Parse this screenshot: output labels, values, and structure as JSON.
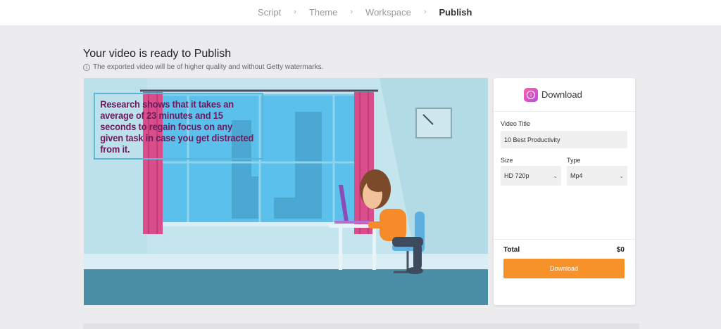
{
  "steps": [
    "Script",
    "Theme",
    "Workspace",
    "Publish"
  ],
  "active_step": "Publish",
  "page": {
    "title": "Your video is ready to Publish",
    "notice": "The exported video will be of higher quality and without Getty watermarks."
  },
  "video": {
    "caption": "Research shows that it takes an average of 23 minutes and 15 seconds to regain focus on any given task in case you get distracted from it."
  },
  "panel": {
    "heading": "Download",
    "video_title_label": "Video Title",
    "video_title_value": "10 Best Productivity",
    "size_label": "Size",
    "size_value": "HD 720p",
    "type_label": "Type",
    "type_value": "Mp4",
    "total_label": "Total",
    "total_value": "$0",
    "download_button": "Download"
  },
  "colors": {
    "accent": "#f7922a",
    "icon_gradient_start": "#ff5fa2",
    "icon_gradient_end": "#b84de8",
    "caption_text": "#6b1a5a"
  },
  "icons": [
    "chevron-right-icon",
    "info-icon",
    "download-icon",
    "chevron-down-icon"
  ]
}
